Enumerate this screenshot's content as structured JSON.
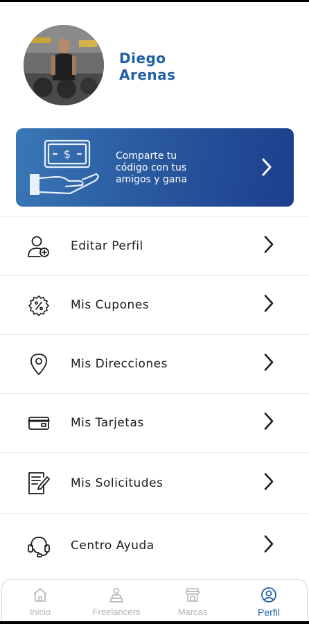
{
  "profile": {
    "name": "Diego\nArenas"
  },
  "referral": {
    "text": "Comparte tu\ncódigo con tus\namigos y gana",
    "icon": "money-hand-icon"
  },
  "menu": {
    "items": [
      {
        "label": "Editar Perfil",
        "icon": "user-edit-icon"
      },
      {
        "label": "Mis Cupones",
        "icon": "coupon-percent-icon"
      },
      {
        "label": "Mis Direcciones",
        "icon": "location-pin-icon"
      },
      {
        "label": "Mis Tarjetas",
        "icon": "credit-card-icon"
      },
      {
        "label": "Mis Solicitudes",
        "icon": "document-edit-icon"
      },
      {
        "label": "Centro Ayuda",
        "icon": "headset-icon"
      }
    ]
  },
  "bottom_nav": {
    "items": [
      {
        "label": "Inicio",
        "icon": "home-icon",
        "active": false
      },
      {
        "label": "Freelancers",
        "icon": "freelancer-icon",
        "active": false
      },
      {
        "label": "Marcas",
        "icon": "store-icon",
        "active": false
      },
      {
        "label": "Perfil",
        "icon": "user-circle-icon",
        "active": true
      }
    ]
  },
  "colors": {
    "accent": "#1f5fa6",
    "banner_start": "#3a78b6",
    "banner_end": "#1c3f8c",
    "inactive": "#b5b5b5"
  }
}
